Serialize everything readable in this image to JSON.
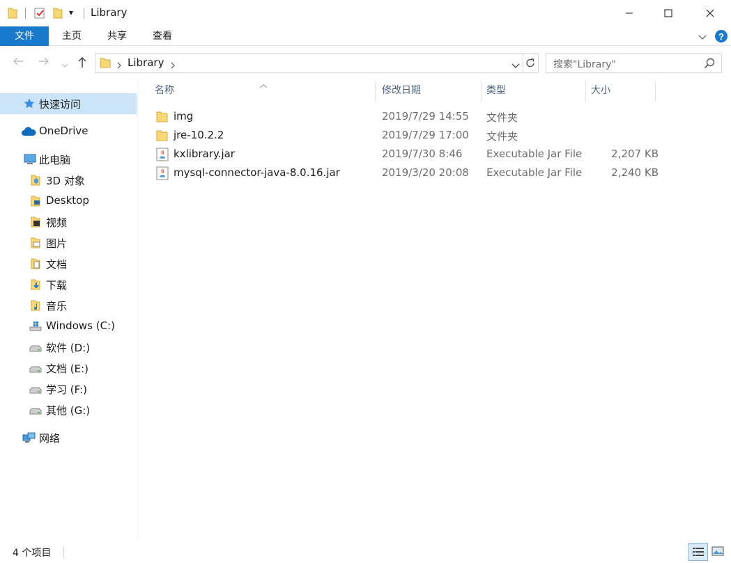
{
  "window": {
    "title": "Library",
    "qat_dropdown": "▾"
  },
  "ribbon": {
    "tabs": [
      "文件",
      "主页",
      "共享",
      "查看"
    ]
  },
  "address": {
    "path": [
      "Library"
    ],
    "search_placeholder": "搜索\"Library\""
  },
  "nav": {
    "quick_access": "快速访问",
    "onedrive": "OneDrive",
    "this_pc": "此电脑",
    "items": [
      {
        "label": "3D 对象",
        "icon": "3d-objects-icon"
      },
      {
        "label": "Desktop",
        "icon": "desktop-icon"
      },
      {
        "label": "视频",
        "icon": "videos-icon"
      },
      {
        "label": "图片",
        "icon": "pictures-icon"
      },
      {
        "label": "文档",
        "icon": "documents-icon"
      },
      {
        "label": "下载",
        "icon": "downloads-icon"
      },
      {
        "label": "音乐",
        "icon": "music-icon"
      },
      {
        "label": "Windows (C:)",
        "icon": "windows-drive-icon"
      },
      {
        "label": "软件 (D:)",
        "icon": "drive-icon"
      },
      {
        "label": "文档 (E:)",
        "icon": "drive-icon"
      },
      {
        "label": "学习 (F:)",
        "icon": "drive-icon"
      },
      {
        "label": "其他 (G:)",
        "icon": "drive-icon"
      }
    ],
    "network": "网络"
  },
  "columns": {
    "name": "名称",
    "date": "修改日期",
    "type": "类型",
    "size": "大小"
  },
  "files": [
    {
      "name": "img",
      "date": "2019/7/29 14:55",
      "type": "文件夹",
      "size": "",
      "icon": "folder-icon"
    },
    {
      "name": "jre-10.2.2",
      "date": "2019/7/29 17:00",
      "type": "文件夹",
      "size": "",
      "icon": "folder-icon"
    },
    {
      "name": "kxlibrary.jar",
      "date": "2019/7/30 8:46",
      "type": "Executable Jar File",
      "size": "2,207 KB",
      "icon": "java-jar-icon"
    },
    {
      "name": "mysql-connector-java-8.0.16.jar",
      "date": "2019/3/20 20:08",
      "type": "Executable Jar File",
      "size": "2,240 KB",
      "icon": "java-jar-icon"
    }
  ],
  "status": {
    "count": "4 个项目"
  },
  "colors": {
    "accent": "#1979ca",
    "selection": "#cce4f7",
    "folder": "#f8d775"
  }
}
